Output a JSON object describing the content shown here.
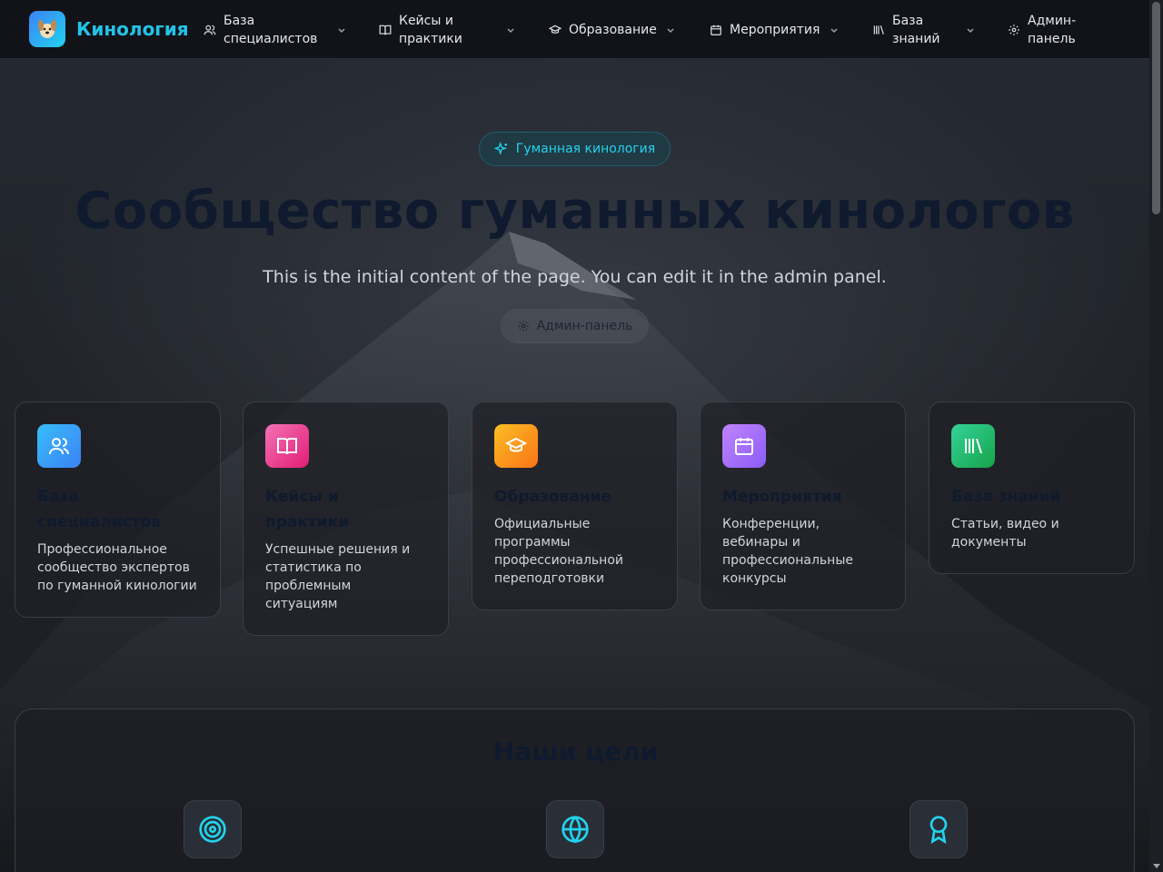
{
  "nav": {
    "brand": "Кинология",
    "items": [
      {
        "label_line1": "База",
        "label_line2": "специалистов",
        "icon": "users-icon"
      },
      {
        "label_line1": "Кейсы и",
        "label_line2": "практики",
        "icon": "book-icon"
      },
      {
        "label": "Образование",
        "icon": "graduation-cap-icon"
      },
      {
        "label": "Мероприятия",
        "icon": "calendar-icon"
      },
      {
        "label_line1": "База",
        "label_line2": "знаний",
        "icon": "library-icon"
      },
      {
        "label_line1": "Админ-",
        "label_line2": "панель",
        "icon": "gear-icon"
      }
    ]
  },
  "hero": {
    "badge": "Гуманная кинология",
    "title": "Сообщество гуманных кинологов",
    "subtitle": "This is the initial content of the page. You can edit it in the admin panel.",
    "button": "Админ-панель"
  },
  "cards": [
    {
      "title_line1": "База",
      "title_line2": "специалистов",
      "description": "Профессиональное сообщество экспертов по гуманной кинологии",
      "color": "#38bdf8",
      "icon": "users-icon"
    },
    {
      "title_line1": "Кейсы и",
      "title_line2": "практики",
      "description": "Успешные решения и статистика по проблемным ситуациям",
      "color": "#f0609e",
      "icon": "book-open-icon"
    },
    {
      "title_line1": "Образование",
      "title_line2": "",
      "description": "Официальные программы профессиональной переподготовки",
      "color": "#fb9a1a",
      "icon": "graduation-cap-icon"
    },
    {
      "title_line1": "Мероприятия",
      "title_line2": "",
      "description": "Конференции, вебинары и профессиональные конкурсы",
      "color": "#a872f5",
      "icon": "calendar-icon"
    },
    {
      "title_line1": "База знаний",
      "title_line2": "",
      "description": "Статьи, видео и документы",
      "color": "#22c77a",
      "icon": "library-icon"
    }
  ],
  "goals": {
    "title": "Наши цели",
    "icons": [
      "target-icon",
      "globe-icon",
      "award-icon"
    ]
  },
  "colors": {
    "accent": "#22d3ee",
    "nav_bg": "#111318",
    "heading_dark": "#0f1a2e"
  }
}
